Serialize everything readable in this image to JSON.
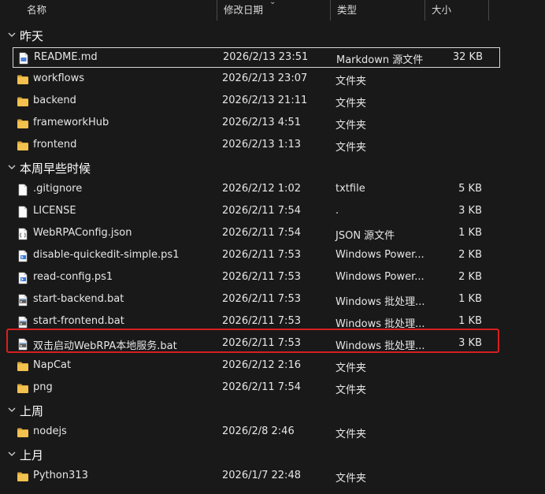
{
  "columns": {
    "name": "名称",
    "date": "修改日期",
    "type": "类型",
    "size": "大小"
  },
  "groups": [
    {
      "title": "昨天",
      "files": [
        {
          "name": "README.md",
          "date": "2026/2/13 23:51",
          "type": "Markdown 源文件",
          "size": "32 KB",
          "icon": "markdown-file-icon"
        },
        {
          "name": "workflows",
          "date": "2026/2/13 23:07",
          "type": "文件夹",
          "size": "",
          "icon": "folder-icon"
        },
        {
          "name": "backend",
          "date": "2026/2/13 21:11",
          "type": "文件夹",
          "size": "",
          "icon": "folder-icon"
        },
        {
          "name": "frameworkHub",
          "date": "2026/2/13 4:51",
          "type": "文件夹",
          "size": "",
          "icon": "folder-icon"
        },
        {
          "name": "frontend",
          "date": "2026/2/13 1:13",
          "type": "文件夹",
          "size": "",
          "icon": "folder-icon"
        }
      ]
    },
    {
      "title": "本周早些时候",
      "files": [
        {
          "name": ".gitignore",
          "date": "2026/2/12 1:02",
          "type": "txtfile",
          "size": "5 KB",
          "icon": "blank-file-icon"
        },
        {
          "name": "LICENSE",
          "date": "2026/2/11 7:54",
          "type": ".",
          "size": "3 KB",
          "icon": "blank-file-icon"
        },
        {
          "name": "WebRPAConfig.json",
          "date": "2026/2/11 7:54",
          "type": "JSON 源文件",
          "size": "1 KB",
          "icon": "json-file-icon"
        },
        {
          "name": "disable-quickedit-simple.ps1",
          "date": "2026/2/11 7:53",
          "type": "Windows Power...",
          "size": "2 KB",
          "icon": "powershell-file-icon"
        },
        {
          "name": "read-config.ps1",
          "date": "2026/2/11 7:53",
          "type": "Windows Power...",
          "size": "2 KB",
          "icon": "powershell-file-icon"
        },
        {
          "name": "start-backend.bat",
          "date": "2026/2/11 7:53",
          "type": "Windows 批处理...",
          "size": "1 KB",
          "icon": "batch-file-icon"
        },
        {
          "name": "start-frontend.bat",
          "date": "2026/2/11 7:53",
          "type": "Windows 批处理...",
          "size": "1 KB",
          "icon": "batch-file-icon"
        },
        {
          "name": "双击启动WebRPA本地服务.bat",
          "date": "2026/2/11 7:53",
          "type": "Windows 批处理...",
          "size": "3 KB",
          "icon": "batch-file-icon"
        },
        {
          "name": "NapCat",
          "date": "2026/2/12 2:16",
          "type": "文件夹",
          "size": "",
          "icon": "folder-icon"
        },
        {
          "name": "png",
          "date": "2026/2/11 7:54",
          "type": "文件夹",
          "size": "",
          "icon": "folder-icon"
        }
      ]
    },
    {
      "title": "上周",
      "files": [
        {
          "name": "nodejs",
          "date": "2026/2/8 2:46",
          "type": "文件夹",
          "size": "",
          "icon": "folder-icon"
        }
      ]
    },
    {
      "title": "上月",
      "files": [
        {
          "name": "Python313",
          "date": "2026/1/7 22:48",
          "type": "文件夹",
          "size": "",
          "icon": "folder-icon"
        }
      ]
    }
  ],
  "colors": {
    "background": "#191919",
    "highlight": "#d81f1f",
    "folder": "#f2c14e"
  }
}
